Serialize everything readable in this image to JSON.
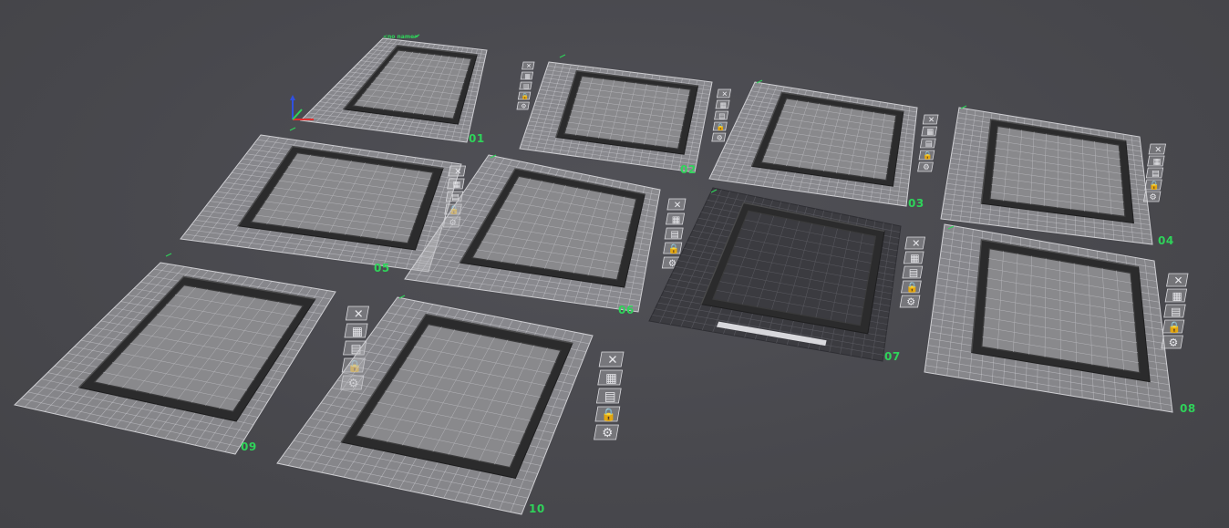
{
  "app": {
    "view": "3D plate preview"
  },
  "axes": {
    "x_color": "#e03030",
    "y_color": "#2fd35a",
    "z_color": "#3050e0"
  },
  "colors": {
    "background": "#4a4a4f",
    "plate_fill": "#b9b9bd",
    "plate_grid": "#d6d6da",
    "plate_border": "#cfcfd3",
    "frame": "#2b2b2c",
    "frame_top": "#3a3a3b",
    "active_plate_fill": "#3b3b40",
    "active_plate_grid": "#5a5a60",
    "accent": "#2fd35a"
  },
  "plates": [
    {
      "label": "01",
      "name": "<no name>",
      "active": false
    },
    {
      "label": "02",
      "name": "",
      "active": false
    },
    {
      "label": "03",
      "name": "",
      "active": false
    },
    {
      "label": "04",
      "name": "",
      "active": false
    },
    {
      "label": "05",
      "name": "",
      "active": false
    },
    {
      "label": "06",
      "name": "",
      "active": false
    },
    {
      "label": "07",
      "name": "",
      "active": true
    },
    {
      "label": "08",
      "name": "",
      "active": false
    },
    {
      "label": "09",
      "name": "",
      "active": false
    },
    {
      "label": "10",
      "name": "",
      "active": false
    }
  ],
  "plate_tools": [
    {
      "name": "delete-plate-icon",
      "glyph": "✕"
    },
    {
      "name": "arrange-icon",
      "glyph": "▦"
    },
    {
      "name": "plate-settings-icon",
      "glyph": "▤"
    },
    {
      "name": "lock-icon",
      "glyph": "🔒"
    },
    {
      "name": "gear-icon",
      "glyph": "⚙"
    }
  ]
}
